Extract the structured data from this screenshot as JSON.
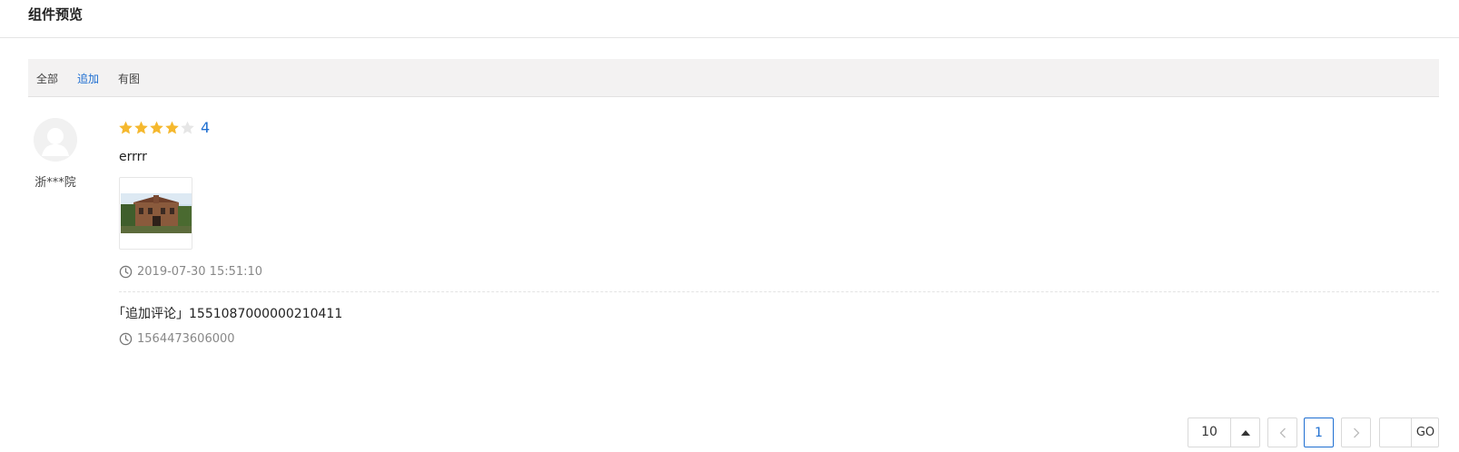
{
  "header": {
    "title": "组件预览"
  },
  "filters": {
    "tabs": [
      "全部",
      "追加",
      "有图"
    ],
    "active": "追加"
  },
  "review": {
    "user_name": "浙***院",
    "rating": 4,
    "rating_label": "4",
    "rating_max": 5,
    "text": "errrr",
    "time": "2019-07-30 15:51:10",
    "append": {
      "text": "「追加评论」1551087000000210411",
      "time": "1564473606000"
    }
  },
  "pagination": {
    "page_size": "10",
    "current_page": "1",
    "jump_input": "",
    "go_label": "GO"
  },
  "colors": {
    "accent": "#1f6fd1",
    "star_on": "#f5b82e",
    "star_off": "#e6e6e6"
  },
  "icons": [
    "user-avatar-icon",
    "star-icon",
    "clock-icon",
    "caret-up-icon",
    "chevron-left-icon",
    "chevron-right-icon"
  ]
}
